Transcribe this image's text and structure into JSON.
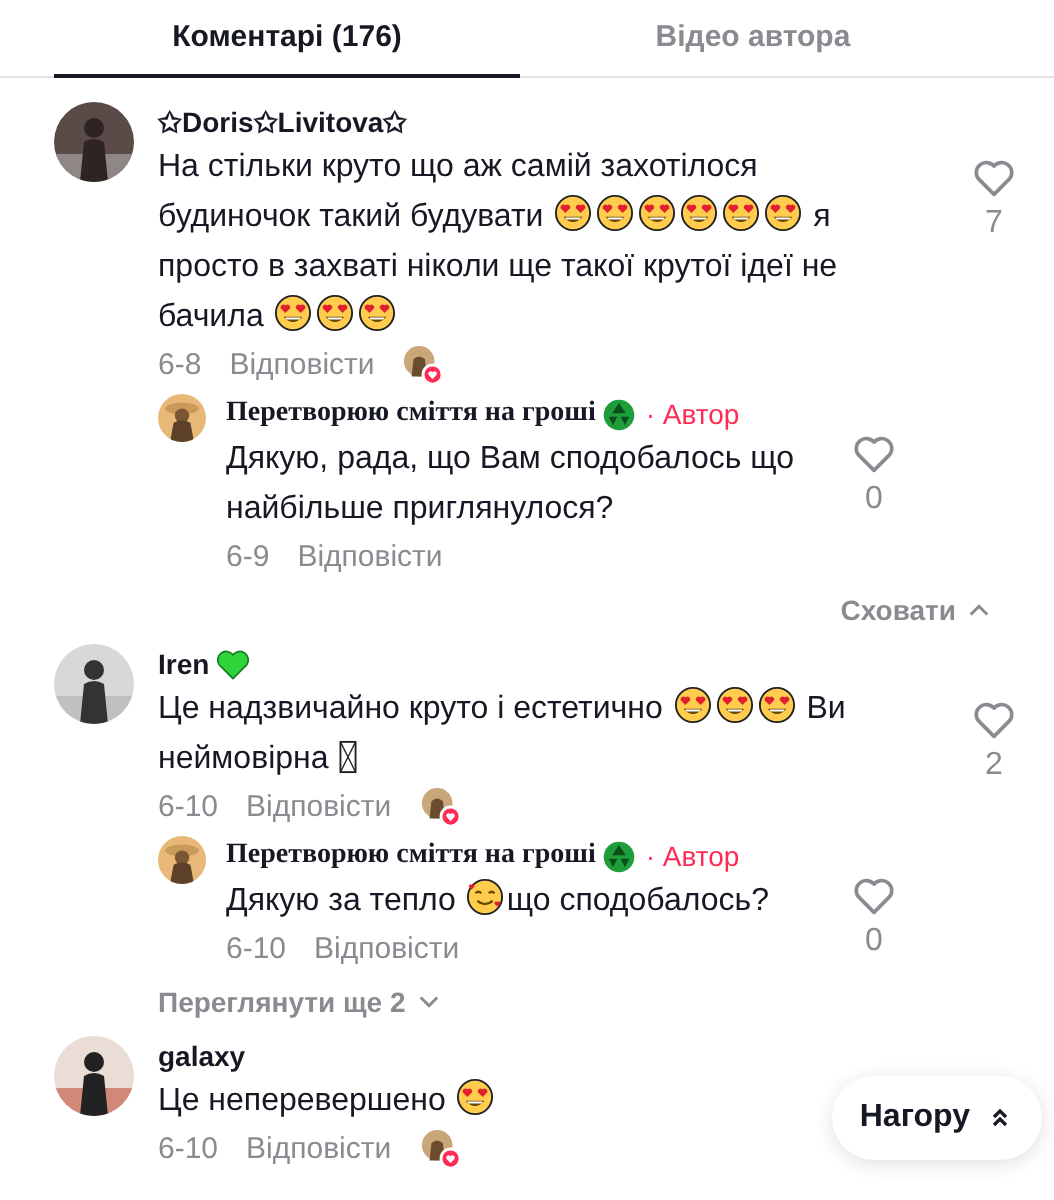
{
  "tabs": [
    {
      "label": "Коментарі (176)",
      "selected": true
    },
    {
      "label": "Відео автора",
      "selected": false
    }
  ],
  "comments": [
    {
      "author": "✩Doris✩Livitova✩",
      "body": [
        {
          "kind": "text",
          "text": "На стільки круто що аж самій захотілося будиночок такий будувати "
        },
        {
          "kind": "heart-eyes"
        },
        {
          "kind": "heart-eyes"
        },
        {
          "kind": "heart-eyes"
        },
        {
          "kind": "heart-eyes"
        },
        {
          "kind": "heart-eyes"
        },
        {
          "kind": "heart-eyes"
        },
        {
          "kind": "text",
          "text": " я просто в захваті ніколи ще такої крутої ідеї не бачила "
        },
        {
          "kind": "heart-eyes"
        },
        {
          "kind": "heart-eyes"
        },
        {
          "kind": "heart-eyes"
        }
      ],
      "date": "6-8",
      "reply": "Відповісти",
      "liked_by_author": true,
      "likes": "7",
      "replies": [
        {
          "author": "Перетворюю сміття на гроші",
          "name_icon": {
            "kind": "recycle"
          },
          "badge": "· Автор",
          "body": [
            {
              "kind": "text",
              "text": "Дякую, рада, що Вам сподобалось що найбільше приглянулося?"
            }
          ],
          "date": "6-9",
          "reply": "Відповісти",
          "likes": "0"
        }
      ],
      "toggle": {
        "label": "Сховати",
        "expanded": true
      }
    },
    {
      "author": "Iren",
      "name_icon": {
        "kind": "green-heart"
      },
      "body": [
        {
          "kind": "text",
          "text": "Це надзвичайно круто і естетично "
        },
        {
          "kind": "heart-eyes"
        },
        {
          "kind": "heart-eyes"
        },
        {
          "kind": "heart-eyes"
        },
        {
          "kind": "text",
          "text": " Ви неймовірна "
        },
        {
          "kind": "missing-glyph"
        }
      ],
      "date": "6-10",
      "reply": "Відповісти",
      "liked_by_author": true,
      "likes": "2",
      "replies": [
        {
          "author": "Перетворюю сміття на гроші",
          "name_icon": {
            "kind": "recycle"
          },
          "badge": "· Автор",
          "body": [
            {
              "kind": "text",
              "text": "Дякую за тепло "
            },
            {
              "kind": "smiling-hearts"
            },
            {
              "kind": "text",
              "text": "що сподобалось?"
            }
          ],
          "date": "6-10",
          "reply": "Відповісти",
          "likes": "0"
        }
      ],
      "toggle": {
        "label": "Переглянути ще 2",
        "expanded": false
      }
    },
    {
      "author": "galaxy",
      "body": [
        {
          "kind": "text",
          "text": "Це неперевершено "
        },
        {
          "kind": "heart-eyes"
        }
      ],
      "date": "6-10",
      "reply": "Відповісти",
      "liked_by_author": true
    }
  ],
  "back_to_top": "Нагору"
}
